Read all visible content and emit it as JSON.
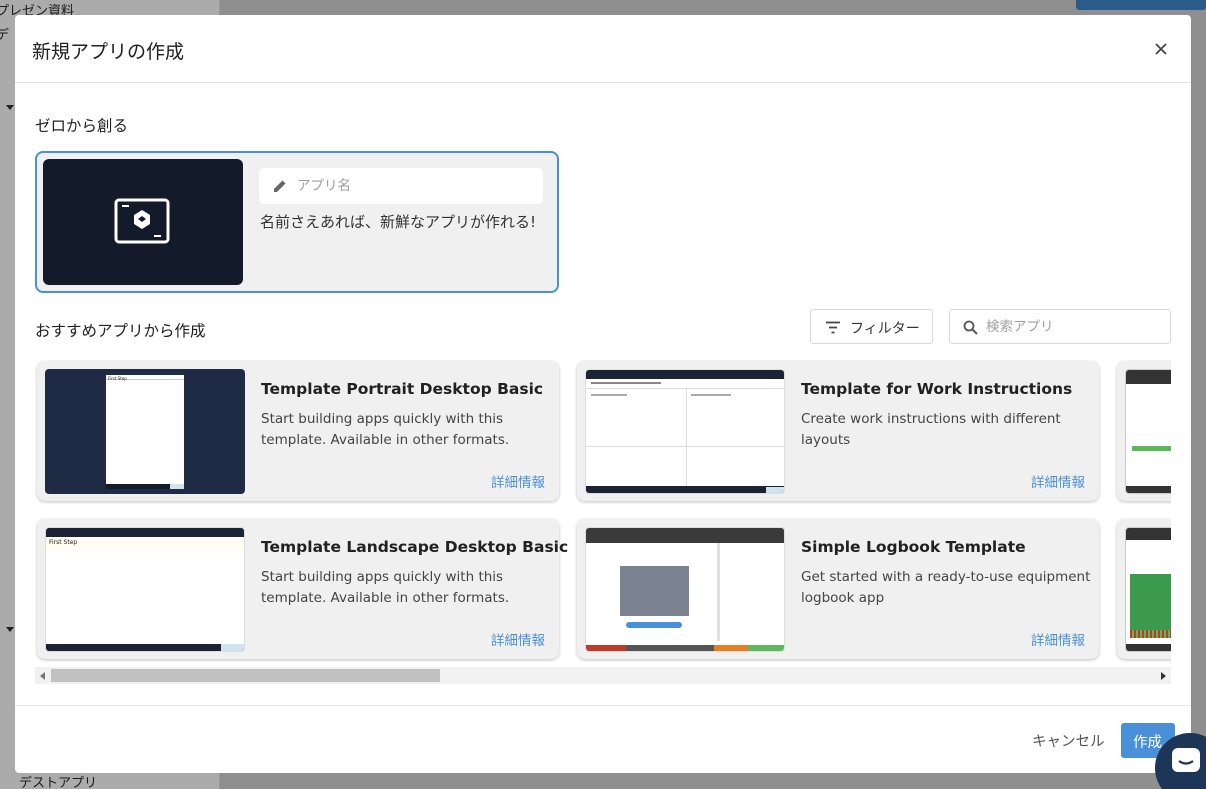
{
  "background": {
    "sidebar_items": [
      "プレゼン資料",
      "デ",
      "デストアプリ"
    ]
  },
  "modal": {
    "title": "新規アプリの作成",
    "close_label": "×"
  },
  "scratch": {
    "section_label": "ゼロから創る",
    "name_placeholder": "アプリ名",
    "description": "名前さえあれば、新鮮なアプリが作れる!"
  },
  "recommended": {
    "section_label": "おすすめアプリから作成",
    "filter_label": "フィルター",
    "search_placeholder": "検索アプリ"
  },
  "templates": [
    {
      "title": "Template Portrait Desktop Basic",
      "description": "Start building apps quickly with this template. Available in other formats.",
      "link": "詳細情報",
      "thumb_label": "First Step"
    },
    {
      "title": "Template for Work Instructions",
      "description": "Create work instructions with different layouts",
      "link": "詳細情報"
    },
    {
      "title": "Template Landscape Desktop Basic",
      "description": "Start building apps quickly with this template. Available in other formats.",
      "link": "詳細情報",
      "thumb_label": "First Step"
    },
    {
      "title": "Simple Logbook Template",
      "description": "Get started with a ready-to-use equipment logbook app",
      "link": "詳細情報"
    }
  ],
  "footer": {
    "cancel_label": "キャンセル",
    "create_label": "作成"
  },
  "colors": {
    "accent": "#4a90d9",
    "dark_thumb": "#131a2a"
  }
}
